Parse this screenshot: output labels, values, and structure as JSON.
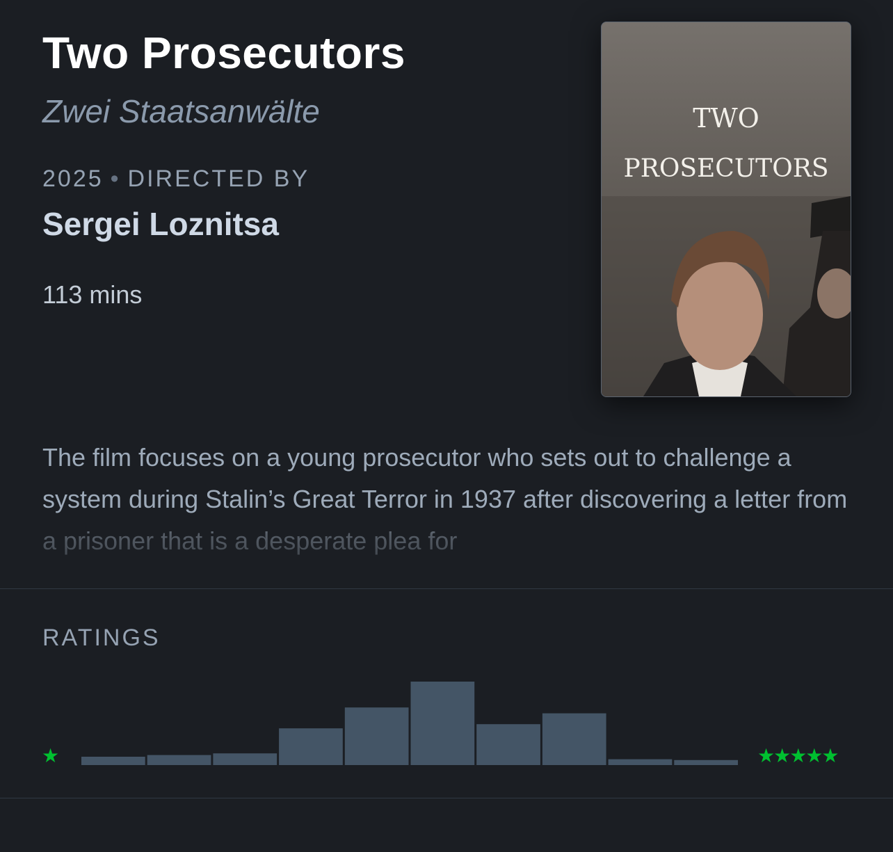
{
  "film": {
    "title": "Two Prosecutors",
    "original_title": "Zwei Staatsanwälte",
    "year": "2025",
    "directed_by_label": "DIRECTED BY",
    "director": "Sergei Loznitsa",
    "runtime": "113 mins",
    "synopsis": "The film focuses on a young prosecutor who sets out to challenge a system during Stalin’s Great Terror in 1937 after discovering a letter from a prisoner that is a desperate plea for"
  },
  "poster": {
    "line1": "TWO",
    "line2": "PROSECUTORS"
  },
  "ratings": {
    "label": "RATINGS",
    "min_stars": "★",
    "max_stars": "★★★★★",
    "star_color": "#00c030",
    "bar_color": "#445566"
  },
  "chart_data": {
    "type": "bar",
    "categories": [
      "0.5",
      "1",
      "1.5",
      "2",
      "2.5",
      "3",
      "3.5",
      "4",
      "4.5",
      "5"
    ],
    "values": [
      10,
      12,
      14,
      44,
      69,
      100,
      49,
      62,
      7,
      6
    ],
    "title": "",
    "xlabel": "",
    "ylabel": ""
  }
}
